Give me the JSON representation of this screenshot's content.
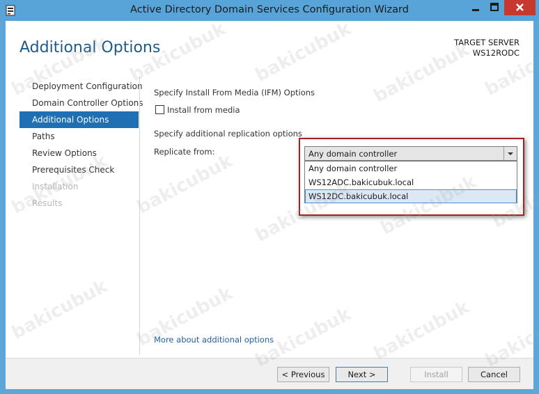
{
  "window": {
    "title": "Active Directory Domain Services Configuration Wizard",
    "accent_color": "#58a3d8",
    "close_color": "#c7392e"
  },
  "header": {
    "title": "Additional Options",
    "target_label": "TARGET SERVER",
    "target_value": "WS12RODC"
  },
  "nav": {
    "items": [
      {
        "label": "Deployment Configuration",
        "state": "normal"
      },
      {
        "label": "Domain Controller Options",
        "state": "normal"
      },
      {
        "label": "Additional Options",
        "state": "selected"
      },
      {
        "label": "Paths",
        "state": "normal"
      },
      {
        "label": "Review Options",
        "state": "normal"
      },
      {
        "label": "Prerequisites Check",
        "state": "normal"
      },
      {
        "label": "Installation",
        "state": "disabled"
      },
      {
        "label": "Results",
        "state": "disabled"
      }
    ]
  },
  "main": {
    "ifm_heading": "Specify Install From Media (IFM) Options",
    "install_from_media_label": "Install from media",
    "install_from_media_checked": false,
    "replication_heading": "Specify additional replication options",
    "replicate_from_label": "Replicate from:",
    "replicate_from_selected": "Any domain controller",
    "replicate_from_options": [
      "Any domain controller",
      "WS12ADC.bakicubuk.local",
      "WS12DC.bakicubuk.local"
    ],
    "hovered_option": "WS12DC.bakicubuk.local",
    "more_link": "More about additional options"
  },
  "footer": {
    "previous": "< Previous",
    "next": "Next >",
    "install": "Install",
    "cancel": "Cancel"
  },
  "watermark": "bakicubuk"
}
